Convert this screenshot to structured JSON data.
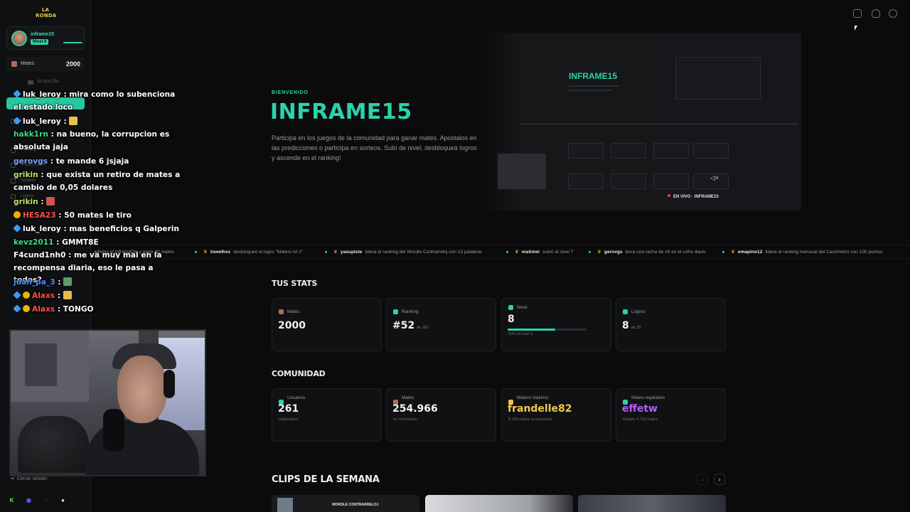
{
  "sidebar": {
    "logo": "LA\nRONDA",
    "user": {
      "name": "inframe15",
      "level": "Nivel 8"
    },
    "mates_label": "Mates",
    "mates_value": "2000",
    "timer": "1h 11m 25s",
    "nav": [
      "Inicio",
      "Perfil",
      "Ranking",
      "Predicciones",
      "Sorteos",
      "Logros"
    ],
    "logout": "Cerrar sesión"
  },
  "chat": [
    {
      "user": "luk_leroy",
      "color": "#ffffff",
      "badges": [
        "mod"
      ],
      "text": " : mira como lo subenciona el estado loco"
    },
    {
      "user": "luk_leroy",
      "color": "#ffffff",
      "badges": [
        "mod"
      ],
      "text": " : ",
      "emote": "#e8c34a"
    },
    {
      "user": "hakk1rn",
      "color": "#3bd98b",
      "badges": [],
      "text": " : na bueno, la corrupcion es absoluta jaja"
    },
    {
      "user": "gerovgs",
      "color": "#7aa4ff",
      "badges": [],
      "text": " : te mande 6 jsjaja"
    },
    {
      "user": "grikin",
      "color": "#b9e36a",
      "badges": [],
      "text": " : que exista un retiro de mates a cambio de 0,05 dolares"
    },
    {
      "user": "grikin",
      "color": "#b9e36a",
      "badges": [],
      "text": " : ",
      "emote": "#d0564e"
    },
    {
      "user": "HESA23",
      "color": "#ff4d4d",
      "badges": [
        "sub"
      ],
      "text": " : 50 mates le tiro"
    },
    {
      "user": "luk_leroy",
      "color": "#ffffff",
      "badges": [
        "mod"
      ],
      "text": " : mas beneficios q Galperin"
    },
    {
      "user": "kevz2011",
      "color": "#3bd98b",
      "badges": [],
      "text": " : GMMT8E"
    },
    {
      "user": "F4cund1nh0",
      "color": "#ffffff",
      "badges": [],
      "text": " : me va muy mal en la recompensa diaria, eso le pasa a todos?"
    },
    {
      "user": "juan_pa_3",
      "color": "#4c8dff",
      "badges": [],
      "text": " : ",
      "emote": "#5aa06a"
    },
    {
      "user": "Alaxs",
      "color": "#ff4d4d",
      "badges": [
        "mod",
        "sub"
      ],
      "text": " : ",
      "emote": "#e8b94a"
    },
    {
      "user": "Alaxs",
      "color": "#ff4d4d",
      "badges": [
        "mod",
        "sub"
      ],
      "text": " : TONGO"
    }
  ],
  "hero": {
    "welcome": "BIENVENIDO",
    "name": "INFRAME15",
    "description": "Participa en los juegos de la comunidad para ganar mates. Apostalos en las predicciones o participa en sorteos. Subí de nivel, desbloqueá logros y ascende en el ranking!",
    "preview_name": "INFRAME15",
    "live_label": "EN VIVO · INFRAME15"
  },
  "ticker": [
    {
      "user": "",
      "text": "adivinó el InframeDle y ganó 40 mates"
    },
    {
      "user": "towelhss",
      "text": "desbloqueó el logro \"Matero lvl 2\""
    },
    {
      "user": "yasupiste",
      "text": "lidera el ranking del Wordle Contrarreloj con 13 palabras"
    },
    {
      "user": "matimei",
      "text": "subió al nivel 7"
    },
    {
      "user": "gerovgs",
      "text": "lleva una racha de x9 en el cofre diario"
    },
    {
      "user": "emapino12",
      "text": "lidera el ranking mensual del Cacómetro con 100 puntos"
    }
  ],
  "stats": {
    "title": "TUS STATS",
    "cards": [
      {
        "label": "Mates",
        "value": "2000",
        "suffix": "",
        "sub": ""
      },
      {
        "label": "Ranking",
        "value": "#52",
        "suffix": "de 262",
        "sub": ""
      },
      {
        "label": "Nivel",
        "value": "8",
        "suffix": "",
        "sub": "60% al nivel 9",
        "progress": 0.6
      },
      {
        "label": "Logros",
        "value": "8",
        "suffix": "de 35",
        "sub": ""
      }
    ]
  },
  "community": {
    "title": "COMUNIDAD",
    "cards": [
      {
        "label": "Usuarios",
        "value": "261",
        "sub": "registrados",
        "color": "#f2f2f2"
      },
      {
        "label": "Mates",
        "value": "254.966",
        "sub": "en circulación",
        "color": "#f2f2f2"
      },
      {
        "label": "Matero máximo",
        "value": "frandelle82",
        "sub": "8.158 mates acumulados",
        "color": "#f2c94c"
      },
      {
        "label": "Mates regalados",
        "value": "effetw",
        "sub": "Regaló 4.710 mates",
        "color": "#b45cff"
      }
    ]
  },
  "clips": {
    "title": "CLIPS DE LA SEMANA",
    "first_clip_caption": "WORDLE CONTRARRELOJ",
    "prev": "‹",
    "next": "›"
  },
  "colors": {
    "accent": "#2bd3a7",
    "background": "#0b0b0c",
    "card": "#101113"
  }
}
